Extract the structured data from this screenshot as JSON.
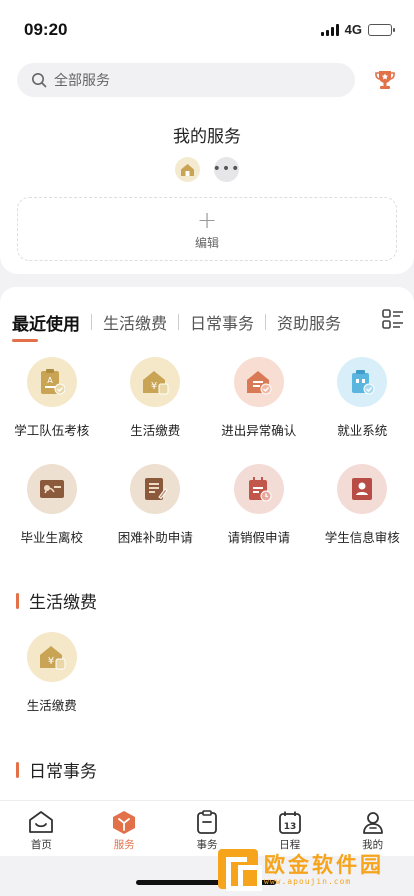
{
  "status": {
    "time": "09:20",
    "network": "4G"
  },
  "search": {
    "placeholder": "全部服务"
  },
  "my_services": {
    "title": "我的服务",
    "more": "•••",
    "edit_label": "编辑"
  },
  "tabs": [
    {
      "label": "最近使用"
    },
    {
      "label": "生活缴费"
    },
    {
      "label": "日常事务"
    },
    {
      "label": "资助服务"
    }
  ],
  "recent": [
    {
      "label": "学工队伍考核",
      "icon": "clipboard-a-icon",
      "color": "gold"
    },
    {
      "label": "生活缴费",
      "icon": "house-yuan-icon",
      "color": "gold"
    },
    {
      "label": "进出异常确认",
      "icon": "house-check-icon",
      "color": "peach"
    },
    {
      "label": "就业系统",
      "icon": "briefcase-check-icon",
      "color": "blue"
    },
    {
      "label": "毕业生离校",
      "icon": "diploma-icon",
      "color": "brown"
    },
    {
      "label": "困难补助申请",
      "icon": "form-pen-icon",
      "color": "brown"
    },
    {
      "label": "请销假申请",
      "icon": "calendar-clock-icon",
      "color": "rose"
    },
    {
      "label": "学生信息审核",
      "icon": "id-card-icon",
      "color": "rose"
    }
  ],
  "sections": [
    {
      "title": "生活缴费",
      "items": [
        {
          "label": "生活缴费",
          "icon": "house-yuan-icon"
        }
      ]
    },
    {
      "title": "日常事务"
    }
  ],
  "nav": [
    {
      "label": "首页",
      "icon": "home-icon"
    },
    {
      "label": "服务",
      "icon": "service-box-icon",
      "active": true
    },
    {
      "label": "事务",
      "icon": "clipboard-icon"
    },
    {
      "label": "日程",
      "icon": "calendar-13-icon",
      "day": "13"
    },
    {
      "label": "我的",
      "icon": "user-icon"
    }
  ],
  "watermark": {
    "text": "欧金软件园",
    "url": "www.apoujin.com"
  },
  "colors": {
    "accent": "#e2714a",
    "gold": "#c9a455",
    "watermark": "#f6a41c"
  }
}
